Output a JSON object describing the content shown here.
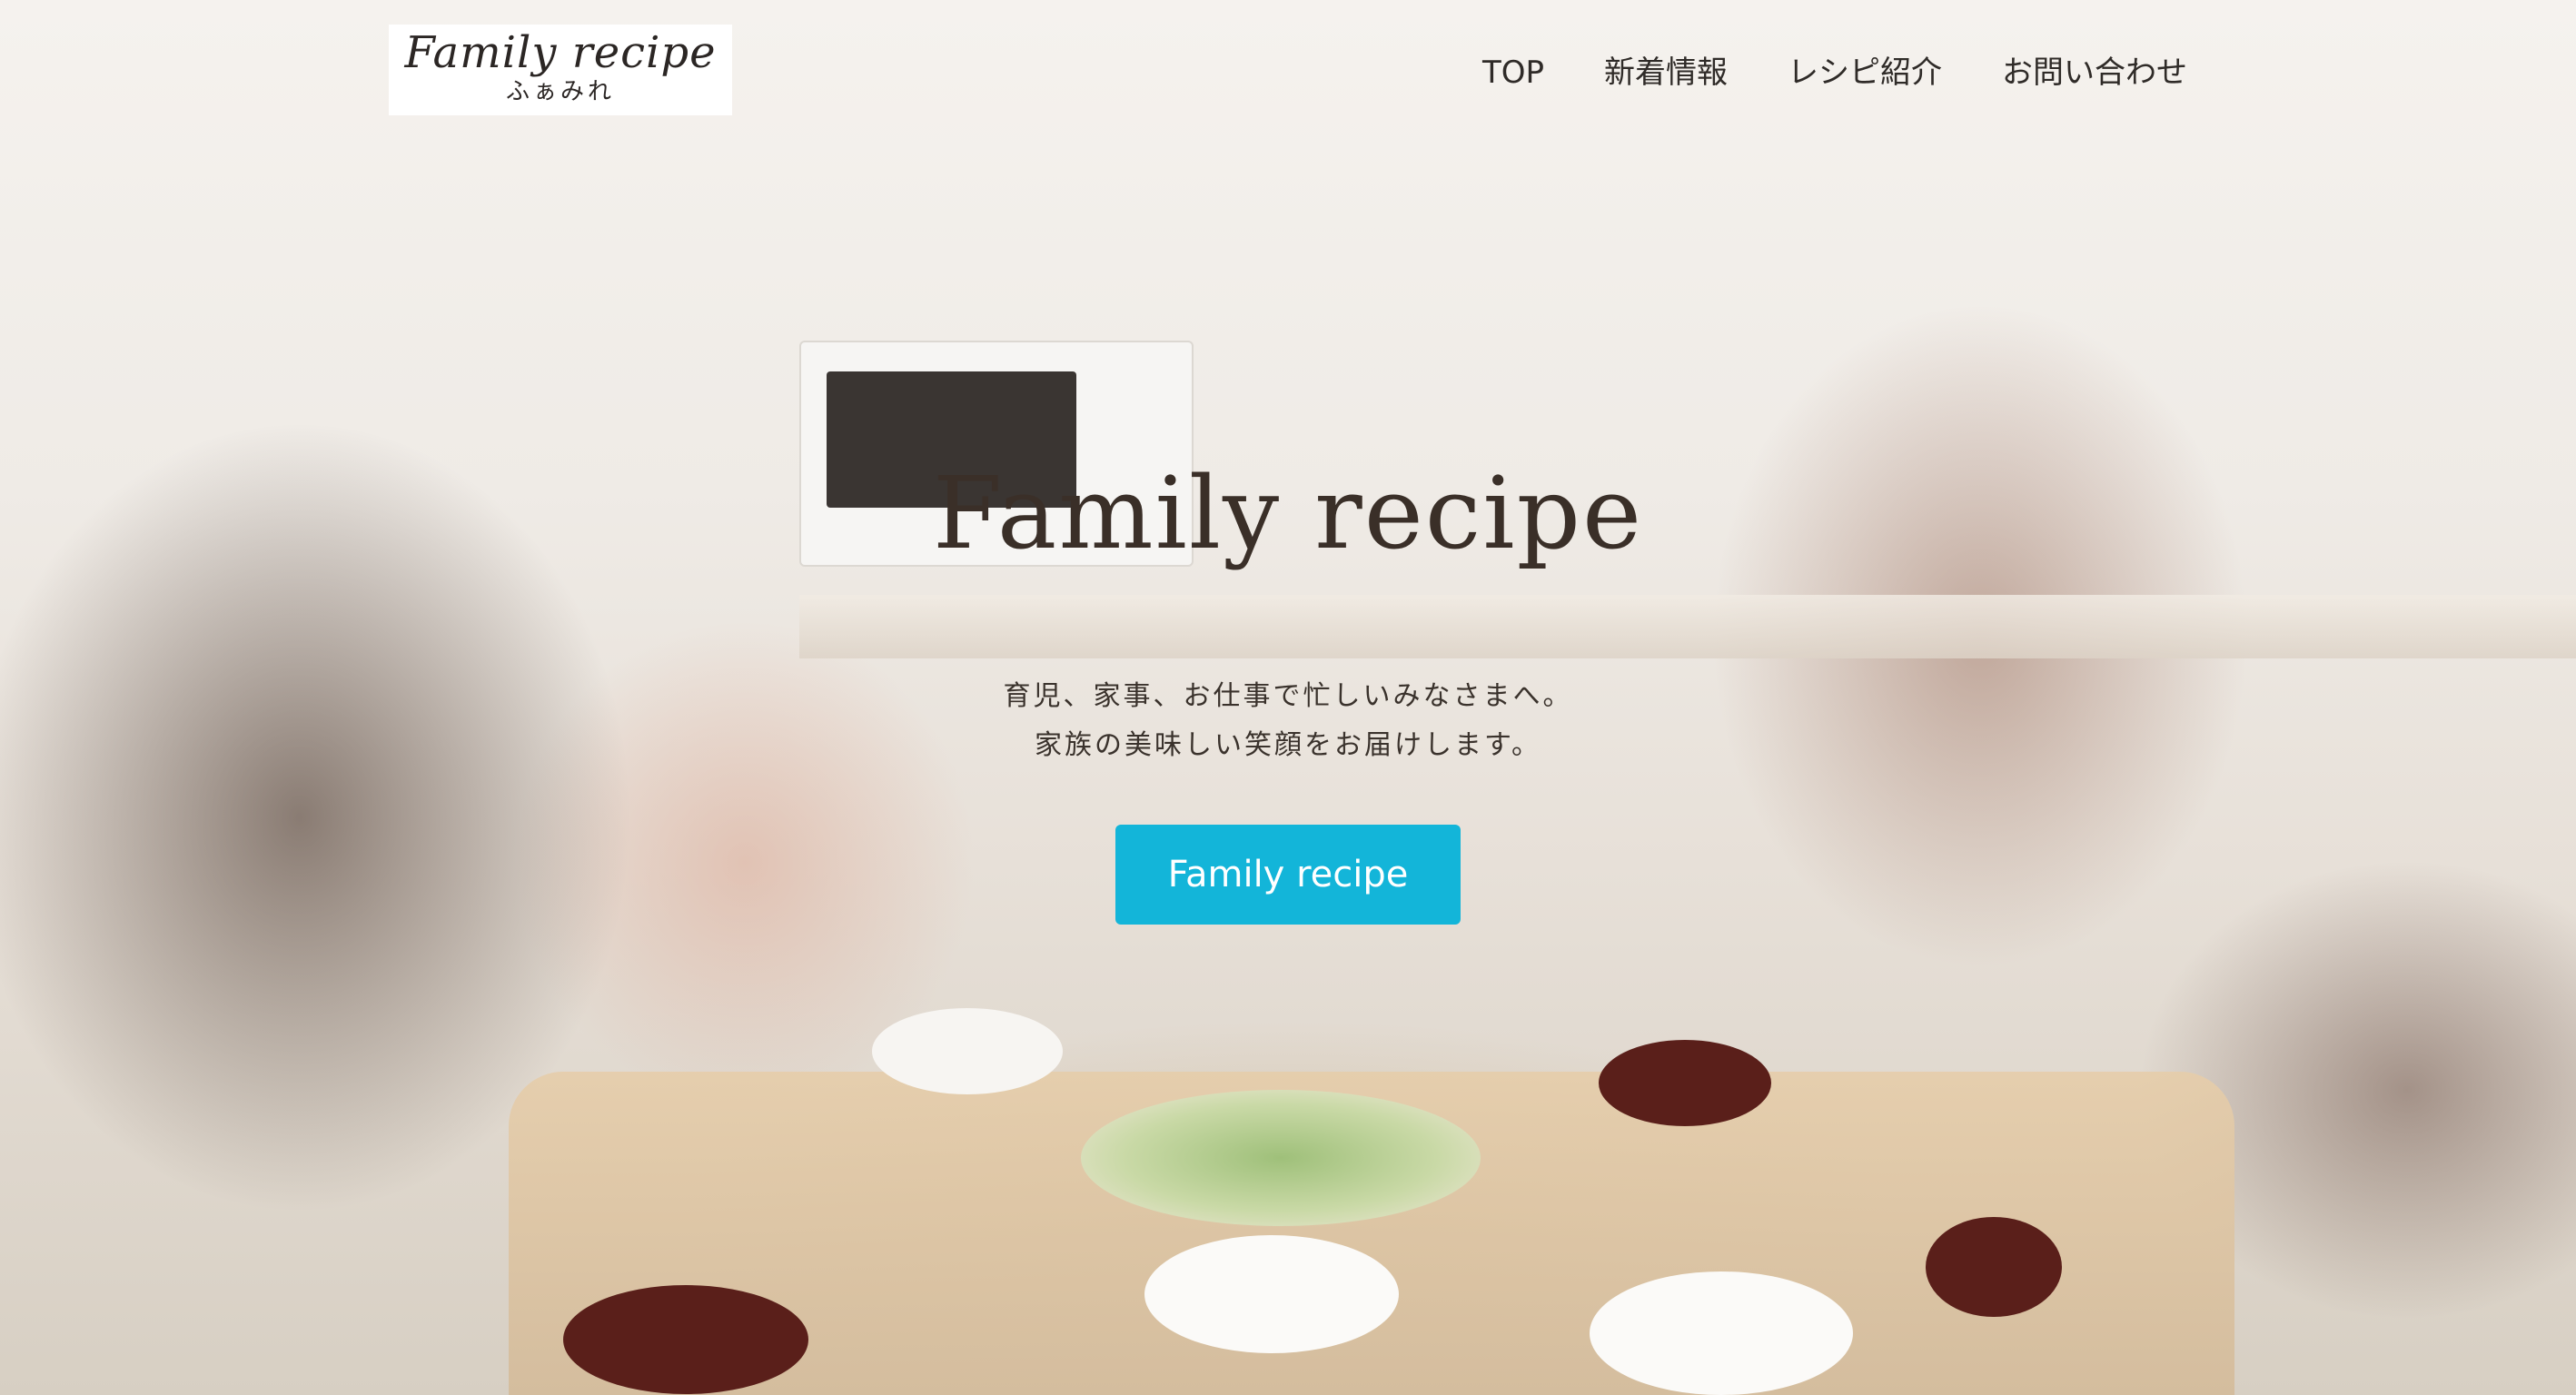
{
  "header": {
    "logo_title": "Family recipe",
    "logo_subtitle": "ふぁみれ",
    "nav": [
      {
        "label": "TOP"
      },
      {
        "label": "新着情報"
      },
      {
        "label": "レシピ紹介"
      },
      {
        "label": "お問い合わせ"
      }
    ]
  },
  "hero": {
    "title": "Family recipe",
    "subtitle_lines": [
      "育児、家事、お仕事で忙しいみなさまへ。",
      "家族の美味しい笑顔をお届けします。"
    ],
    "cta_label": "Family recipe",
    "image_description": "family-dining-photo"
  },
  "colors": {
    "cta_background": "#13b5d9",
    "text": "#3a2f28"
  }
}
